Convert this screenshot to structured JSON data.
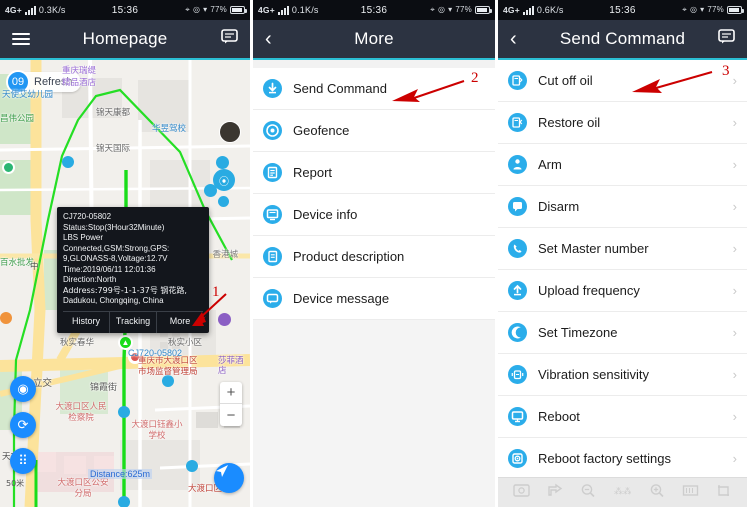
{
  "screens": [
    {
      "id": "homepage",
      "statusbar": {
        "network": "4G+",
        "speed": "0.3K/s",
        "time": "15:36",
        "battery": "77%"
      },
      "nav": {
        "title": "Homepage",
        "left_icon": "hamburger-icon",
        "right_icon": "chat-bubble-icon"
      },
      "map": {
        "refresh": {
          "count": "09",
          "label": "Refresh"
        },
        "distance_label": "Distance:625m",
        "scale_label": "50米",
        "device_label": "CJ720-05802",
        "zoom_in": "+",
        "zoom_out": "−",
        "place_labels": [
          "重庆瑞缇",
          "精品酒店",
          "锦天康都",
          "华昱驾校",
          "天使艾幼儿园",
          "昌伟公园",
          "锦天国际",
          "百水批发",
          "秋实春华",
          "秋实小区",
          "九中立交",
          "锦霞街",
          "大渡口区人民检察院",
          "大渡口区公安分局",
          "大渡口钰鑫小学校",
          "莎菲酒店",
          "重庆市大渡口区市场监督管理局",
          "大渡口区",
          "天友",
          "中",
          "茂 · 香港城"
        ]
      },
      "popup": {
        "device_id": "CJ720-05802",
        "lines": [
          "Status:Stop(3Hour32Minute)",
          "LBS Power",
          "Connected,GSM:Strong,GPS:",
          "9,GLONASS-8,Voltage:12.7V",
          "Time:2019/06/11 12:01:36",
          "Direction:North",
          "Address:799号-1-1-37号 钢花路,",
          "Dadukou, Chongqing, China"
        ],
        "buttons": [
          "History",
          "Tracking",
          "More"
        ]
      }
    },
    {
      "id": "more",
      "statusbar": {
        "network": "4G+",
        "speed": "0.1K/s",
        "time": "15:36",
        "battery": "77%"
      },
      "nav": {
        "title": "More",
        "left_icon": "back-chevron-icon"
      },
      "items": [
        {
          "label": "Send Command",
          "icon": "download-circle-icon"
        },
        {
          "label": "Geofence",
          "icon": "target-circle-icon"
        },
        {
          "label": "Report",
          "icon": "document-circle-icon"
        },
        {
          "label": "Device info",
          "icon": "monitor-circle-icon"
        },
        {
          "label": "Product description",
          "icon": "book-circle-icon"
        },
        {
          "label": "Device message",
          "icon": "message-circle-icon"
        }
      ]
    },
    {
      "id": "send-command",
      "statusbar": {
        "network": "4G+",
        "speed": "0.6K/s",
        "time": "15:36",
        "battery": "77%"
      },
      "nav": {
        "title": "Send Command",
        "left_icon": "back-chevron-icon",
        "right_icon": "chat-bubble-icon"
      },
      "items": [
        {
          "label": "Cut off oil",
          "icon": "fuel-cut-circle-icon",
          "chevron": "›"
        },
        {
          "label": "Restore oil",
          "icon": "fuel-restore-circle-icon",
          "chevron": "›"
        },
        {
          "label": "Arm",
          "icon": "lock-person-circle-icon",
          "chevron": "›"
        },
        {
          "label": "Disarm",
          "icon": "flag-circle-icon",
          "chevron": "›"
        },
        {
          "label": "Set Master number",
          "icon": "phone-circle-icon",
          "chevron": "›"
        },
        {
          "label": "Upload frequency",
          "icon": "upload-circle-icon",
          "chevron": "›"
        },
        {
          "label": "Set Timezone",
          "icon": "moon-circle-icon",
          "chevron": "›"
        },
        {
          "label": "Vibration sensitivity",
          "icon": "vibration-circle-icon",
          "chevron": "›"
        },
        {
          "label": "Reboot",
          "icon": "monitor-reboot-circle-icon",
          "chevron": "›"
        },
        {
          "label": "Reboot factory settings",
          "icon": "factory-reset-circle-icon",
          "chevron": "›"
        }
      ],
      "bottom_tools": [
        "screenshot-tool",
        "share-tool",
        "zoom-out-tool",
        "blur-tool",
        "zoom-in-tool",
        "keyboard-tool",
        "crop-tool"
      ]
    }
  ],
  "annotations": [
    {
      "number": "1",
      "target": "more-popup-button"
    },
    {
      "number": "2",
      "target": "send-command-menu-item"
    },
    {
      "number": "3",
      "target": "cut-off-oil-command"
    }
  ],
  "colors": {
    "nav_bg": "#2c3341",
    "nav_accent": "#2bbfd4",
    "icon_blue": "#2badea",
    "annotation_red": "#cc0000",
    "route_green": "#19dd19"
  }
}
